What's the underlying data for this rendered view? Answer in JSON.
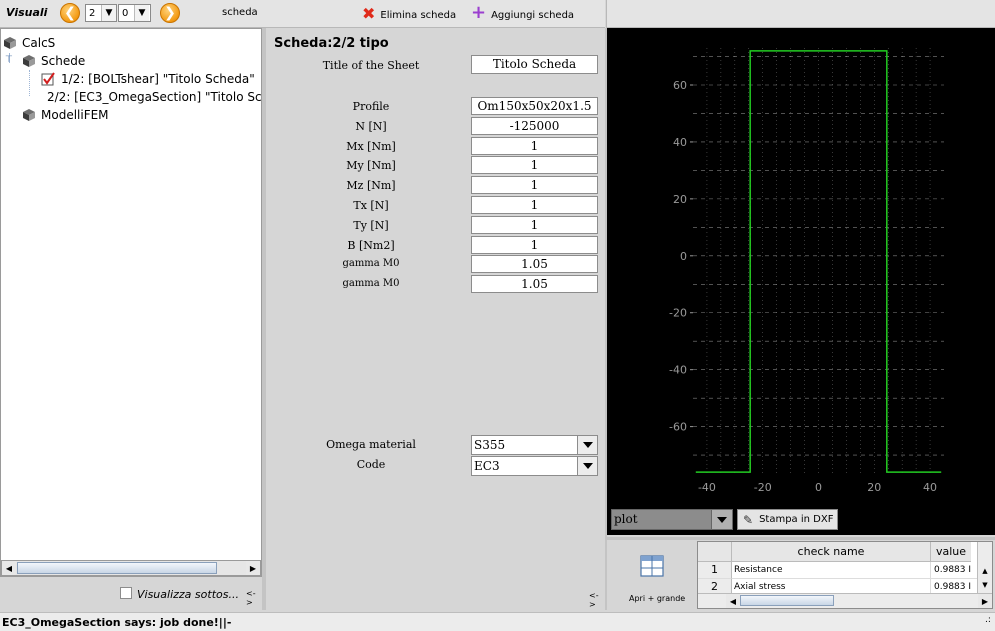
{
  "toolbar": {
    "visuali_label": "Visuali",
    "page_value": "2",
    "sub_value": "0",
    "scheda_label": "scheda",
    "delete_label": "Elimina scheda",
    "add_label": "Aggiungi scheda"
  },
  "tree": {
    "root": "CalcS",
    "schede": "Schede",
    "item1": "1/2: [BOLTshear] \"Titolo Scheda\"",
    "item2": "2/2: [EC3_OmegaSection] \"Titolo Scheda\"",
    "modelli": "ModelliFEM"
  },
  "left_footer": {
    "show_subs_label": "Visualizza sottos...",
    "resize_glyph": "<->"
  },
  "form": {
    "heading": "Scheda:2/2 tipo",
    "title_label": "Title of the Sheet",
    "title_value": "Titolo Scheda",
    "fields": [
      {
        "label": "Profile",
        "value": "Om150x50x20x1.5"
      },
      {
        "label": "N [N]",
        "value": "-125000"
      },
      {
        "label": "Mx [Nm]",
        "value": "1"
      },
      {
        "label": "My [Nm]",
        "value": "1"
      },
      {
        "label": "Mz [Nm]",
        "value": "1"
      },
      {
        "label": "Tx [N]",
        "value": "1"
      },
      {
        "label": "Ty [N]",
        "value": "1"
      },
      {
        "label": "B [Nm2]",
        "value": "1"
      },
      {
        "label": "gamma M0",
        "value": "1.05"
      },
      {
        "label": "gamma M0",
        "value": "1.05"
      }
    ],
    "material_label": "Omega material",
    "material_value": "S355",
    "code_label": "Code",
    "code_value": "EC3",
    "resize_glyph": "<->"
  },
  "plot": {
    "select_value": "plot",
    "dxf_label": "Stampa in DXF",
    "colors": {
      "profile": "#22cc22",
      "axis": "#e6d24a",
      "grid": "#bdbdbd"
    }
  },
  "chart_data": {
    "type": "line",
    "title": "",
    "xlabel": "",
    "ylabel": "",
    "xlim": [
      -45,
      45
    ],
    "ylim": [
      -77,
      73
    ],
    "xticks": [
      -40,
      -20,
      0,
      20,
      40
    ],
    "yticks": [
      60,
      40,
      20,
      0,
      -20,
      -40,
      -60
    ],
    "grid": true,
    "series": [
      {
        "x": [
          -44,
          -24.5,
          -24.5,
          24.5,
          24.5,
          44
        ],
        "y": [
          -76,
          -76,
          72,
          72,
          -76,
          -76
        ]
      }
    ],
    "axis_lines": [
      {
        "x": [
          -24.5,
          -24.5
        ],
        "y": [
          40,
          -75
        ]
      },
      {
        "x": [
          24.5,
          24.5
        ],
        "y": [
          40,
          -75
        ]
      }
    ]
  },
  "results": {
    "open_big_label": "Apri + grande",
    "col_check": "check name",
    "col_value": "value",
    "rows": [
      {
        "num": "1",
        "name": "Resistance",
        "value": "0.9883 I"
      },
      {
        "num": "2",
        "name": "Axial stress",
        "value": "0.9883 I"
      }
    ]
  },
  "status": {
    "message": "EC3_OmegaSection says: job done!||-",
    "grip": ".:"
  }
}
